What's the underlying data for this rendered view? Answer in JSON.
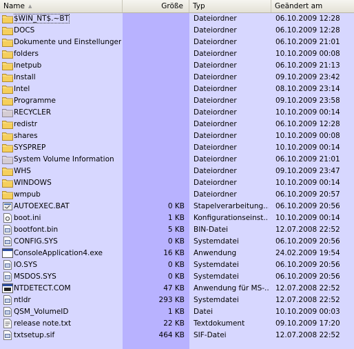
{
  "header": {
    "name": "Name",
    "size": "Größe",
    "type": "Typ",
    "date": "Geändert am"
  },
  "files": [
    {
      "name": "$WIN_NT$.~BT",
      "size": "",
      "type": "Dateiordner",
      "date": "06.10.2009 12:28",
      "icon": "folder-icon"
    },
    {
      "name": "DOCS",
      "size": "",
      "type": "Dateiordner",
      "date": "06.10.2009 12:28",
      "icon": "folder-icon"
    },
    {
      "name": "Dokumente und Einstellungen",
      "size": "",
      "type": "Dateiordner",
      "date": "06.10.2009 21:01",
      "icon": "folder-icon"
    },
    {
      "name": "folders",
      "size": "",
      "type": "Dateiordner",
      "date": "10.10.2009 00:08",
      "icon": "folder-icon"
    },
    {
      "name": "Inetpub",
      "size": "",
      "type": "Dateiordner",
      "date": "06.10.2009 21:13",
      "icon": "folder-icon"
    },
    {
      "name": "Install",
      "size": "",
      "type": "Dateiordner",
      "date": "09.10.2009 23:42",
      "icon": "folder-icon"
    },
    {
      "name": "Intel",
      "size": "",
      "type": "Dateiordner",
      "date": "08.10.2009 23:14",
      "icon": "folder-icon"
    },
    {
      "name": "Programme",
      "size": "",
      "type": "Dateiordner",
      "date": "09.10.2009 23:58",
      "icon": "folder-icon"
    },
    {
      "name": "RECYCLER",
      "size": "",
      "type": "Dateiordner",
      "date": "10.10.2009 00:14",
      "icon": "system-folder-icon"
    },
    {
      "name": "redistr",
      "size": "",
      "type": "Dateiordner",
      "date": "06.10.2009 12:28",
      "icon": "folder-icon"
    },
    {
      "name": "shares",
      "size": "",
      "type": "Dateiordner",
      "date": "10.10.2009 00:08",
      "icon": "folder-icon"
    },
    {
      "name": "SYSPREP",
      "size": "",
      "type": "Dateiordner",
      "date": "10.10.2009 00:14",
      "icon": "folder-icon"
    },
    {
      "name": "System Volume Information",
      "size": "",
      "type": "Dateiordner",
      "date": "06.10.2009 21:01",
      "icon": "system-folder-icon"
    },
    {
      "name": "WHS",
      "size": "",
      "type": "Dateiordner",
      "date": "09.10.2009 23:47",
      "icon": "folder-icon"
    },
    {
      "name": "WINDOWS",
      "size": "",
      "type": "Dateiordner",
      "date": "10.10.2009 00:14",
      "icon": "folder-icon"
    },
    {
      "name": "wmpub",
      "size": "",
      "type": "Dateiordner",
      "date": "06.10.2009 20:57",
      "icon": "folder-icon"
    },
    {
      "name": "AUTOEXEC.BAT",
      "size": "0 KB",
      "type": "Stapelverarbeitung...",
      "date": "06.10.2009 20:56",
      "icon": "batch-file-icon"
    },
    {
      "name": "boot.ini",
      "size": "1 KB",
      "type": "Konfigurationseinst...",
      "date": "10.10.2009 00:14",
      "icon": "config-file-icon"
    },
    {
      "name": "bootfont.bin",
      "size": "5 KB",
      "type": "BIN-Datei",
      "date": "12.07.2008 22:52",
      "icon": "system-file-icon"
    },
    {
      "name": "CONFIG.SYS",
      "size": "0 KB",
      "type": "Systemdatei",
      "date": "06.10.2009 20:56",
      "icon": "system-file-icon"
    },
    {
      "name": "ConsoleApplication4.exe",
      "size": "16 KB",
      "type": "Anwendung",
      "date": "24.02.2009 19:54",
      "icon": "application-icon"
    },
    {
      "name": "IO.SYS",
      "size": "0 KB",
      "type": "Systemdatei",
      "date": "06.10.2009 20:56",
      "icon": "system-file-icon"
    },
    {
      "name": "MSDOS.SYS",
      "size": "0 KB",
      "type": "Systemdatei",
      "date": "06.10.2009 20:56",
      "icon": "system-file-icon"
    },
    {
      "name": "NTDETECT.COM",
      "size": "47 KB",
      "type": "Anwendung für MS-...",
      "date": "12.07.2008 22:52",
      "icon": "dos-application-icon"
    },
    {
      "name": "ntldr",
      "size": "293 KB",
      "type": "Systemdatei",
      "date": "12.07.2008 22:52",
      "icon": "system-file-icon"
    },
    {
      "name": "QSM_VolumeID",
      "size": "1 KB",
      "type": "Datei",
      "date": "10.10.2009 00:03",
      "icon": "system-file-icon"
    },
    {
      "name": "release note.txt",
      "size": "22 KB",
      "type": "Textdokument",
      "date": "09.10.2009 17:20",
      "icon": "text-file-icon"
    },
    {
      "name": "txtsetup.sif",
      "size": "464 KB",
      "type": "SIF-Datei",
      "date": "12.07.2008 22:52",
      "icon": "system-file-icon"
    }
  ],
  "colors": {
    "list_background": "#d7d7ff",
    "sorted_column_background": "#b8b2ff",
    "folder_yellow": "#f5cf5c",
    "system_folder": "#c8c0c8"
  }
}
